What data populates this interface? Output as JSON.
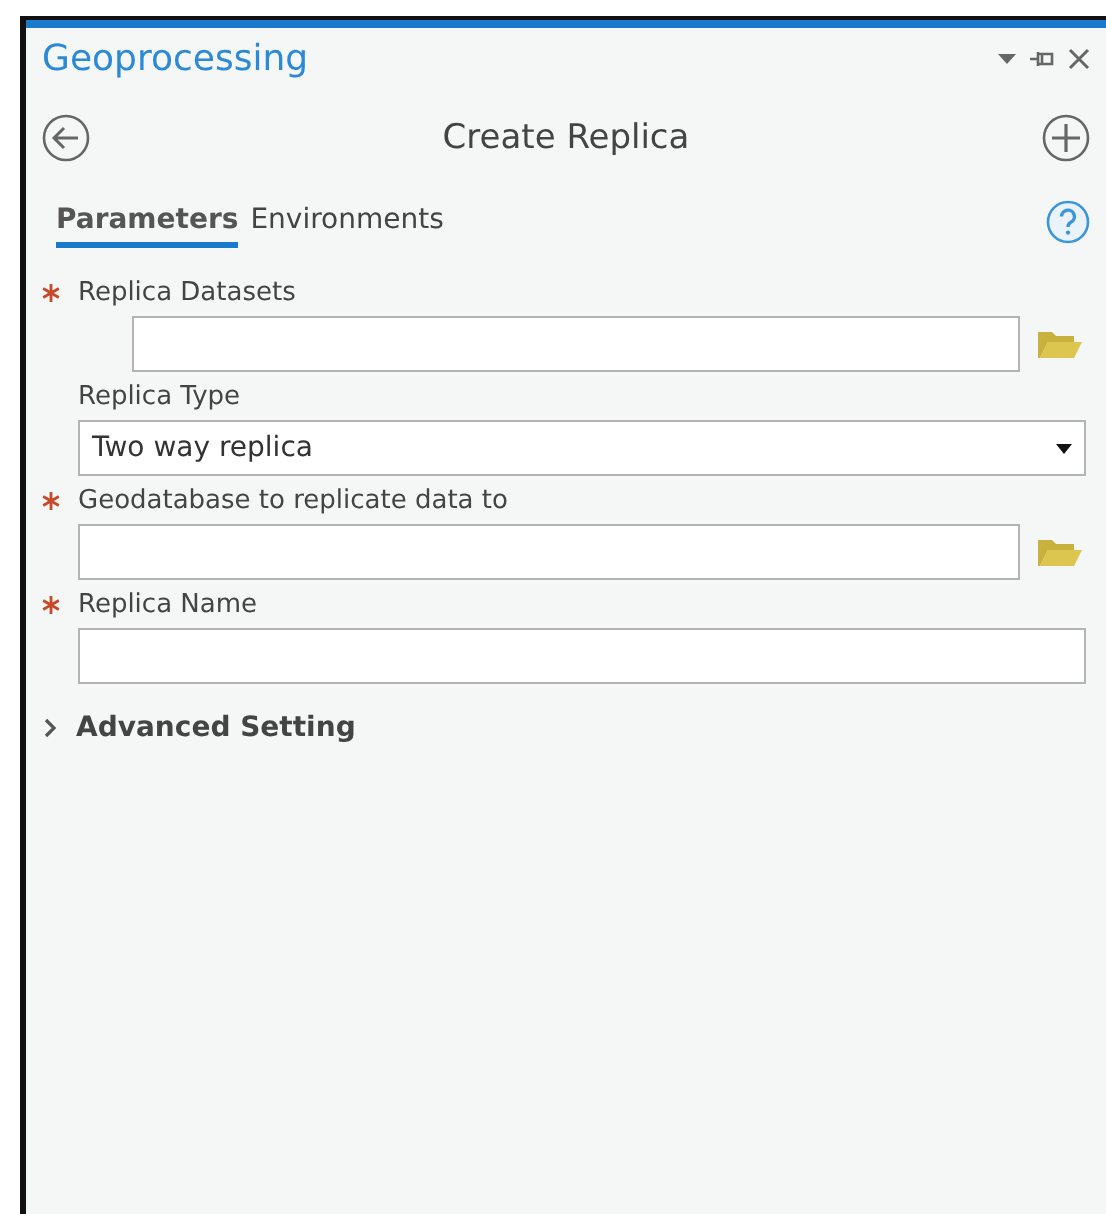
{
  "pane": {
    "title": "Geoprocessing"
  },
  "tool": {
    "title": "Create Replica"
  },
  "tabs": [
    {
      "label": "Parameters",
      "selected": true
    },
    {
      "label": "Environments",
      "selected": false
    }
  ],
  "parameters": [
    {
      "label": "Replica Datasets",
      "required": true,
      "kind": "text",
      "browse": true,
      "multivalue": true
    },
    {
      "label": "Replica Type",
      "required": false,
      "kind": "dropdown",
      "browse": false,
      "multivalue": false,
      "value": "Two way replica"
    },
    {
      "label": "Geodatabase to replicate data to",
      "required": true,
      "kind": "text",
      "browse": true,
      "multivalue": false
    },
    {
      "label": "Replica Name",
      "required": true,
      "kind": "text",
      "browse": false,
      "multivalue": false
    }
  ],
  "sections": [
    {
      "label": "Advanced Setting",
      "expanded": false
    }
  ]
}
